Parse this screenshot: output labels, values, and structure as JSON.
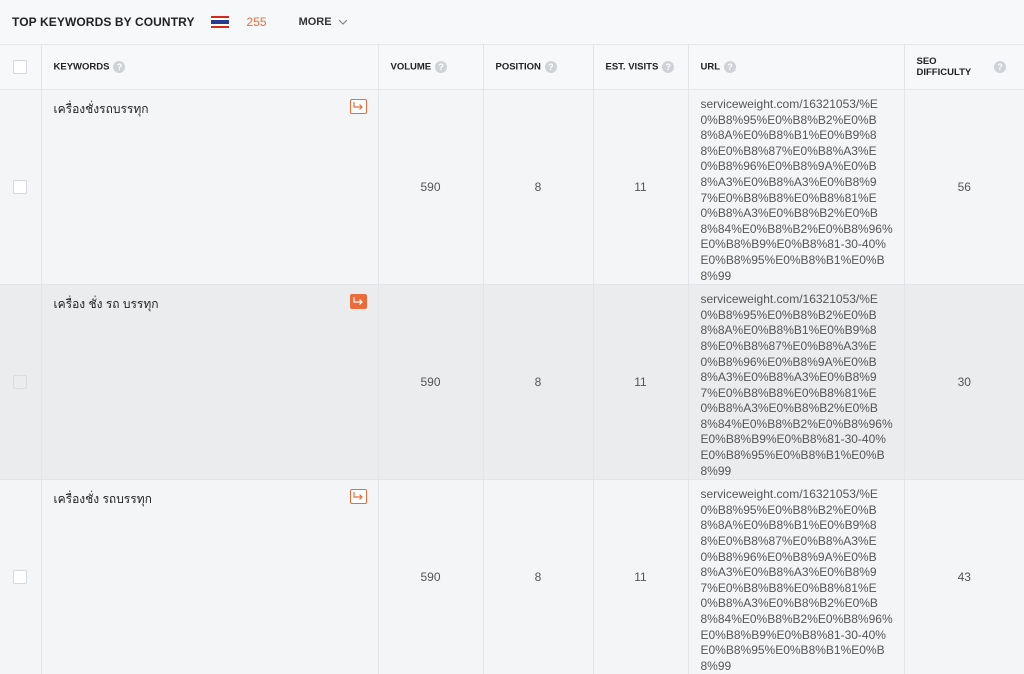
{
  "header": {
    "title": "TOP KEYWORDS BY COUNTRY",
    "count": "255",
    "more_label": "MORE"
  },
  "columns": {
    "keywords": "KEYWORDS",
    "volume": "VOLUME",
    "position": "POSITION",
    "est_visits": "EST. VISITS",
    "url": "URL",
    "seo_line1": "SEO",
    "seo_line2": "DIFFICULTY"
  },
  "rows": [
    {
      "keyword": "เครื่องชั่งรถบรรทุก",
      "volume": "590",
      "position": "8",
      "visits": "11",
      "url": "serviceweight.com/16321053/%E0%B8%95%E0%B8%B2%E0%B8%8A%E0%B8%B1%E0%B9%88%E0%B8%87%E0%B8%A3%E0%B8%96%E0%B8%9A%E0%B8%A3%E0%B8%A3%E0%B8%97%E0%B8%B8%E0%B8%81%E0%B8%A3%E0%B8%B2%E0%B8%84%E0%B8%B2%E0%B8%96%E0%B8%B9%E0%B8%81-30-40%E0%B8%95%E0%B8%B1%E0%B8%99",
      "seo": "56"
    },
    {
      "keyword": "เครื่อง ชั่ง รถ บรรทุก",
      "volume": "590",
      "position": "8",
      "visits": "11",
      "url": "serviceweight.com/16321053/%E0%B8%95%E0%B8%B2%E0%B8%8A%E0%B8%B1%E0%B9%88%E0%B8%87%E0%B8%A3%E0%B8%96%E0%B8%9A%E0%B8%A3%E0%B8%A3%E0%B8%97%E0%B8%B8%E0%B8%81%E0%B8%A3%E0%B8%B2%E0%B8%84%E0%B8%B2%E0%B8%96%E0%B8%B9%E0%B8%81-30-40%E0%B8%95%E0%B8%B1%E0%B8%99",
      "seo": "30"
    },
    {
      "keyword": "เครื่องชั่ง รถบรรทุก",
      "volume": "590",
      "position": "8",
      "visits": "11",
      "url": "serviceweight.com/16321053/%E0%B8%95%E0%B8%B2%E0%B8%8A%E0%B8%B1%E0%B9%88%E0%B8%87%E0%B8%A3%E0%B8%96%E0%B8%9A%E0%B8%A3%E0%B8%A3%E0%B8%97%E0%B8%B8%E0%B8%81%E0%B8%A3%E0%B8%B2%E0%B8%84%E0%B8%B2%E0%B8%96%E0%B8%B9%E0%B8%81-30-40%E0%B8%95%E0%B8%B1%E0%B8%99",
      "seo": "43"
    }
  ],
  "icons": {
    "help": "question-icon",
    "flag": "thailand-flag-icon",
    "open": "open-link-icon",
    "chevron": "chevron-down-icon"
  },
  "colors": {
    "accent": "#ec6b3b",
    "background": "#f4f5f7",
    "row_highlight": "#ebecee"
  }
}
